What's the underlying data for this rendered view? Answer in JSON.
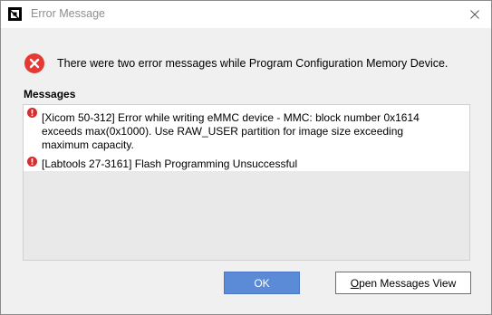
{
  "window": {
    "title": "Error Message",
    "close_icon": "close-icon",
    "app_icon": "amd-logo-icon"
  },
  "header": {
    "icon": "error-circle-icon",
    "icon_color": "#e53935",
    "summary": "There were two error messages while Program Configuration Memory Device."
  },
  "messages": {
    "label": "Messages",
    "items": [
      {
        "icon": "error-icon",
        "lines": [
          "[Xicom 50-312] Error while writing eMMC device - MMC: block number 0x1614",
          "exceeds max(0x1000). Use RAW_USER partition for image size exceeding",
          "maximum capacity."
        ]
      },
      {
        "icon": "error-icon",
        "lines": [
          "[Labtools 27-3161] Flash Programming Unsuccessful"
        ]
      }
    ]
  },
  "buttons": {
    "ok": "OK",
    "open_view_mnemonic": "O",
    "open_view_rest": "pen Messages View",
    "accent": "#5b8ad6"
  }
}
